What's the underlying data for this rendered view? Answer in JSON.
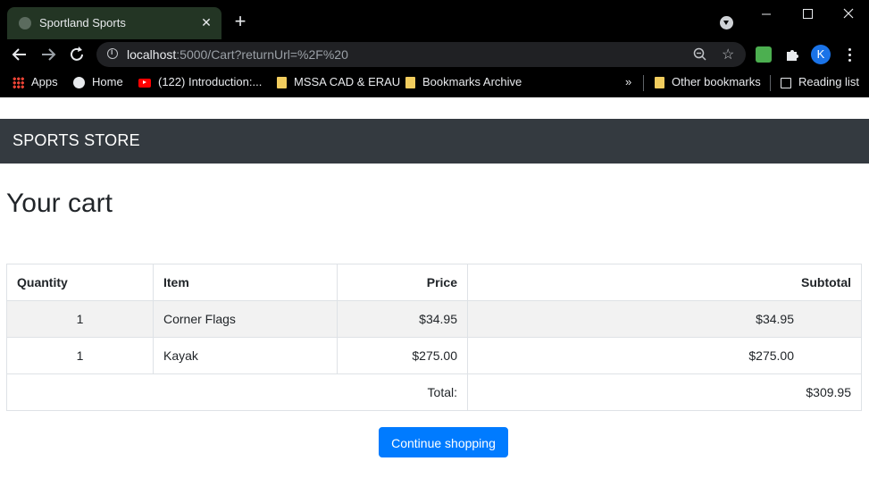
{
  "browser": {
    "tab_title": "Sportland Sports",
    "url_host": "localhost",
    "url_rest": ":5000/Cart?returnUrl=%2F%20",
    "avatar_letter": "K",
    "bookmarks": [
      "Apps",
      "Home",
      "(122) Introduction:...",
      "MSSA CAD & ERAU",
      "Bookmarks Archive"
    ],
    "overflow_label": "»",
    "other_bookmarks": "Other bookmarks",
    "reading_list": "Reading list"
  },
  "navbar": {
    "brand": "SPORTS STORE"
  },
  "page": {
    "heading": "Your cart"
  },
  "cart": {
    "headers": {
      "quantity": "Quantity",
      "item": "Item",
      "price": "Price",
      "subtotal": "Subtotal"
    },
    "rows": [
      {
        "quantity": "1",
        "item": "Corner Flags",
        "price": "$34.95",
        "subtotal": "$34.95"
      },
      {
        "quantity": "1",
        "item": "Kayak",
        "price": "$275.00",
        "subtotal": "$275.00"
      }
    ],
    "total_label": "Total:",
    "total_value": "$309.95"
  },
  "actions": {
    "continue_label": "Continue shopping"
  },
  "colors": {
    "navbar": "#343a40",
    "primary": "#007bff",
    "tab_active": "#233524"
  }
}
